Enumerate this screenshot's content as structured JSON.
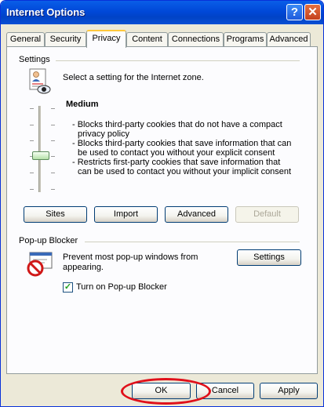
{
  "window": {
    "title": "Internet Options",
    "help_symbol": "?",
    "close_symbol": "✕"
  },
  "tabs": [
    {
      "label": "General"
    },
    {
      "label": "Security"
    },
    {
      "label": "Privacy"
    },
    {
      "label": "Content"
    },
    {
      "label": "Connections"
    },
    {
      "label": "Programs"
    },
    {
      "label": "Advanced"
    }
  ],
  "active_tab": "Privacy",
  "settings": {
    "group_label": "Settings",
    "intro": "Select a setting for the Internet zone.",
    "level": "Medium",
    "slider_level_index": 3,
    "slider_levels_count": 6,
    "bullets": [
      "- Blocks third-party cookies that do not have a compact",
      "privacy policy",
      "- Blocks third-party cookies that save information that can",
      "be used to contact you without your explicit consent",
      "- Restricts first-party cookies that save information that",
      "can be used to contact you without your implicit consent"
    ],
    "buttons": {
      "sites": "Sites",
      "import": "Import",
      "advanced": "Advanced",
      "default": "Default"
    }
  },
  "popup": {
    "group_label": "Pop-up Blocker",
    "text_line1": "Prevent most pop-up windows from",
    "text_line2": "appearing.",
    "settings_button": "Settings",
    "checkbox_label": "Turn on Pop-up Blocker",
    "checkbox_checked": true,
    "check_mark": "✓"
  },
  "footer": {
    "ok": "OK",
    "cancel": "Cancel",
    "apply": "Apply"
  },
  "colors": {
    "titlebar": "#0a5ee8",
    "highlight_ellipse": "#e0101a",
    "active_tab_accent": "#ffc83c"
  }
}
